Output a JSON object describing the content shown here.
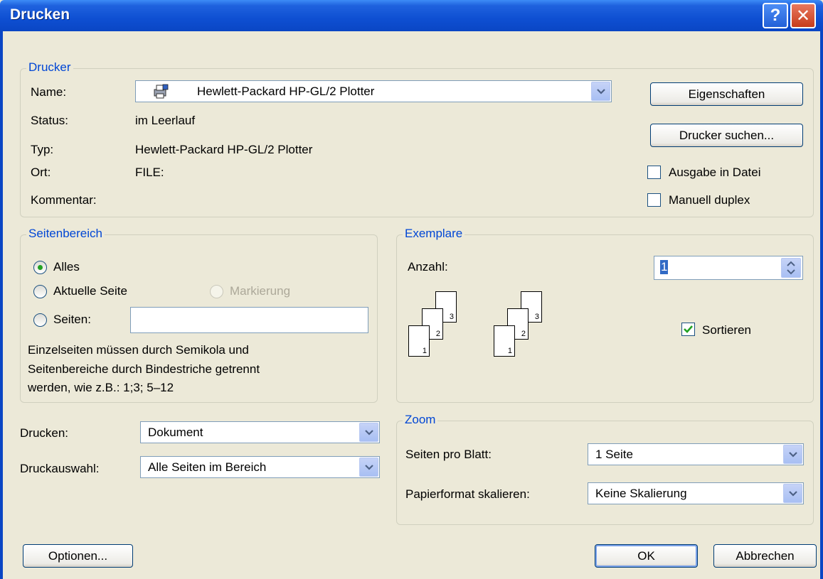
{
  "window": {
    "title": "Drucken",
    "help_label": "?",
    "close_label": "✕"
  },
  "printer": {
    "group_title": "Drucker",
    "name_label": "Name:",
    "name_value": "Hewlett-Packard HP-GL/2 Plotter",
    "status_label": "Status:",
    "status_value": "im Leerlauf",
    "type_label": "Typ:",
    "type_value": "Hewlett-Packard HP-GL/2 Plotter",
    "location_label": "Ort:",
    "location_value": "FILE:",
    "comment_label": "Kommentar:",
    "properties_button": "Eigenschaften",
    "find_printer_button": "Drucker suchen...",
    "print_to_file_label": "Ausgabe in Datei",
    "print_to_file_checked": false,
    "manual_duplex_label": "Manuell duplex",
    "manual_duplex_checked": false
  },
  "page_range": {
    "group_title": "Seitenbereich",
    "all_label": "Alles",
    "current_page_label": "Aktuelle Seite",
    "selection_label": "Markierung",
    "pages_label": "Seiten:",
    "pages_value": "",
    "selected": "all",
    "hint": "Einzelseiten müssen durch Semikola und Seitenbereiche durch Bindestriche getrennt werden, wie z.B.: 1;3; 5–12",
    "hint_line1": "Einzelseiten müssen durch Semikola und",
    "hint_line2": "Seitenbereiche durch Bindestriche getrennt",
    "hint_line3": "werden, wie z.B.: 1;3; 5–12"
  },
  "copies": {
    "group_title": "Exemplare",
    "count_label": "Anzahl:",
    "count_value": "1",
    "collate_label": "Sortieren",
    "collate_checked": true,
    "page_numbers": [
      "1",
      "2",
      "3"
    ]
  },
  "print_what": {
    "print_label": "Drucken:",
    "print_value": "Dokument",
    "print_selection_label": "Druckauswahl:",
    "print_selection_value": "Alle Seiten im Bereich"
  },
  "zoom": {
    "group_title": "Zoom",
    "pages_per_sheet_label": "Seiten pro Blatt:",
    "pages_per_sheet_value": "1 Seite",
    "scale_label": "Papierformat skalieren:",
    "scale_value": "Keine Skalierung"
  },
  "footer": {
    "options_button": "Optionen...",
    "ok_button": "OK",
    "cancel_button": "Abbrechen"
  },
  "colors": {
    "accent": "#0046d5",
    "titlebar": "#0a46c4",
    "background": "#ece9d8"
  }
}
